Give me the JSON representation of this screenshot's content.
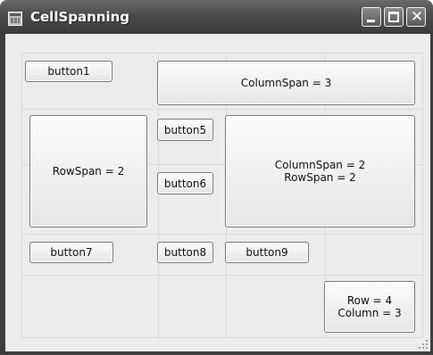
{
  "window": {
    "title": "CellSpanning",
    "minimize_label": "",
    "maximize_label": "",
    "close_glyph": "✕"
  },
  "buttons": {
    "button1": "button1",
    "columnspan3": "ColumnSpan = 3",
    "rowspan2": "RowSpan = 2",
    "button5": "button5",
    "button6": "button6",
    "colrowspan_line1": "ColumnSpan = 2",
    "colrowspan_line2": "RowSpan = 2",
    "button7": "button7",
    "button8": "button8",
    "button9": "button9",
    "rowcol_line1": "Row = 4",
    "rowcol_line2": "Column = 3"
  },
  "icons": {
    "app": "app-window-icon",
    "minimize": "minimize-icon",
    "maximize": "maximize-icon",
    "close": "close-icon",
    "resize": "resize-grip-icon"
  }
}
